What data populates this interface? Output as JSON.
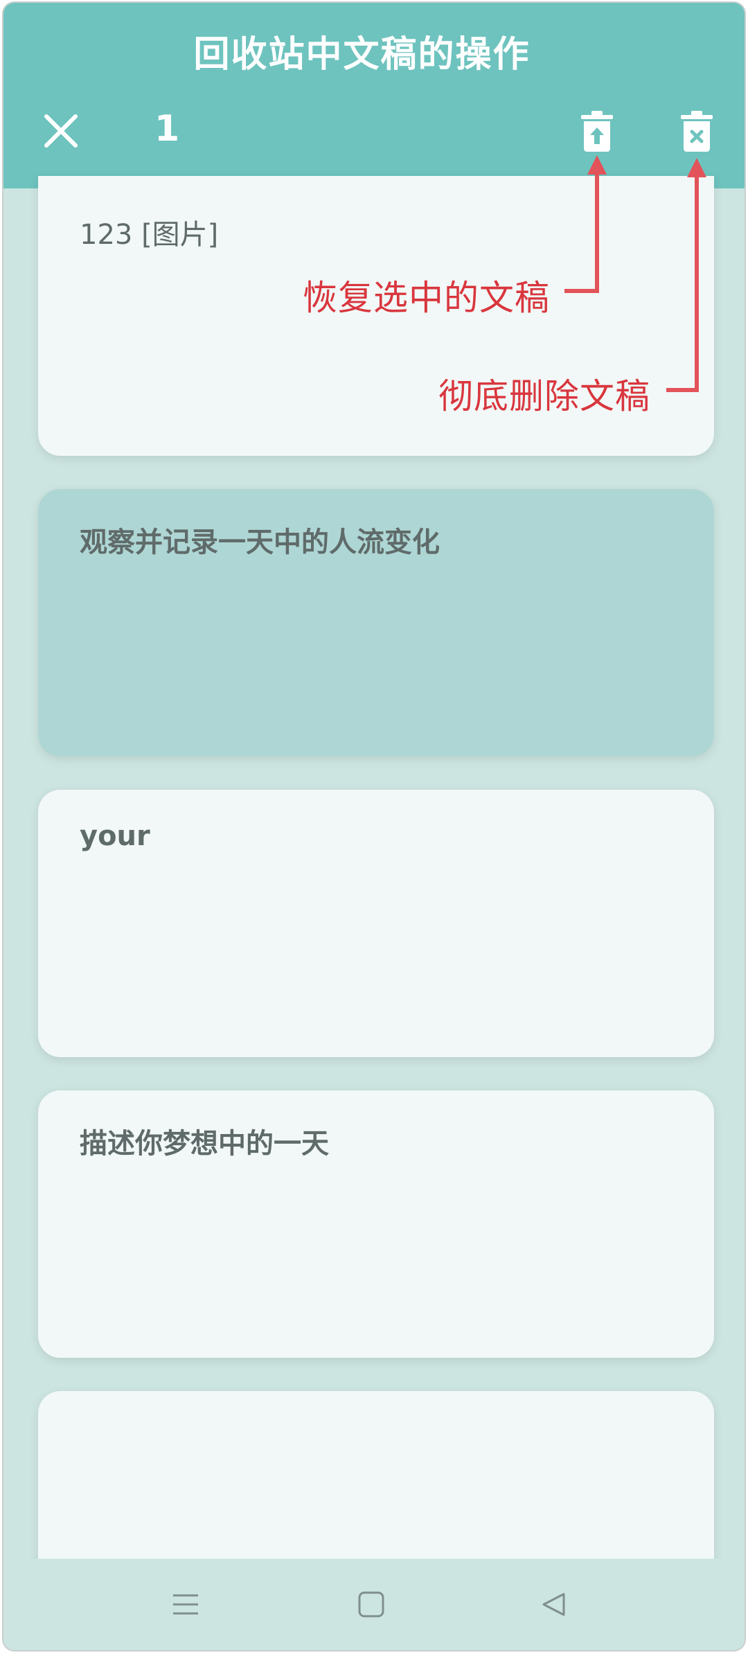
{
  "header": {
    "title": "回收站中文稿的操作",
    "selected_count": "1",
    "close_icon": "close-icon",
    "restore_icon": "trash-restore-icon",
    "delete_icon": "trash-delete-forever-icon"
  },
  "cards": [
    {
      "text": "123 [图片]",
      "selected": false
    },
    {
      "text": "观察并记录一天中的人流变化",
      "selected": true
    },
    {
      "text": "your",
      "selected": false
    },
    {
      "text": "描述你梦想中的一天",
      "selected": false
    },
    {
      "text": "",
      "selected": false
    }
  ],
  "annotations": {
    "restore_label": "恢复选中的文稿",
    "delete_label": "彻底删除文稿",
    "color": "#d9363e"
  },
  "navbar": {
    "menu_icon": "menu-icon",
    "home_icon": "home-square-icon",
    "back_icon": "back-triangle-icon"
  },
  "colors": {
    "header": "#6ec3be",
    "background": "#cde5e1",
    "card": "#f2f8f7",
    "card_selected": "#aed6d4"
  }
}
